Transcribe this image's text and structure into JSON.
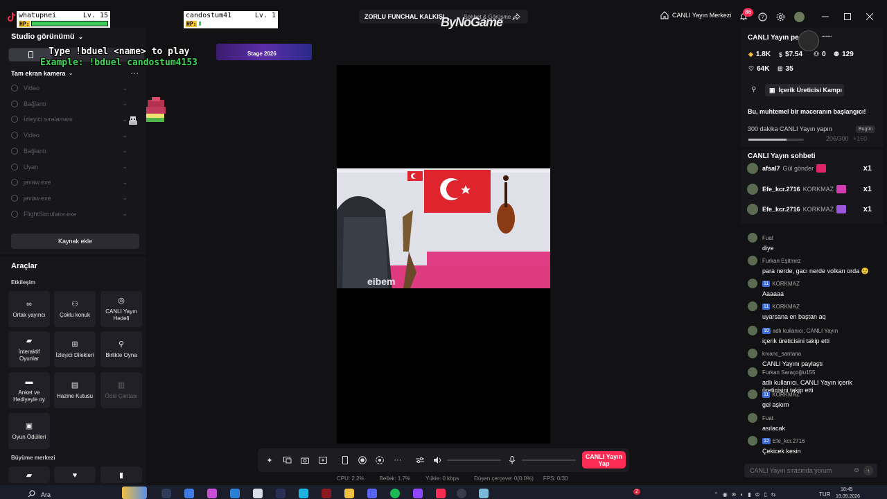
{
  "titlebar": {
    "player1": {
      "name": "whatupnei",
      "level": "Lv. 15",
      "hp_label": "HP:",
      "hp": 1.0
    },
    "player2": {
      "name": "candostum41",
      "level": "Lv. 1",
      "hp_label": "HP:",
      "hp": 0.02
    },
    "stream_title": "ZORLU FUNCHAL KALKIŞI",
    "stream_subtitle": "Sohbet & Görüşme",
    "watermark": "ByNoGame",
    "live_center_label": "CANLI Yayın Merkezi",
    "notification_count": "86"
  },
  "left_panel": {
    "studio_view_label": "Studio görünümü",
    "camera_section": "Tam ekran kamera",
    "sources": [
      "Video",
      "Bağlantı",
      "İzleyici sıralaması",
      "Video",
      "Bağlantı",
      "Uyarı",
      "javaw.exe",
      "javaw.exe",
      "FlightSimulator.exe"
    ],
    "add_source_label": "Kaynak ekle"
  },
  "tools": {
    "title": "Araçlar",
    "interaction_label": "Etkileşim",
    "growth_label": "Büyüme merkezi",
    "items": [
      {
        "label": "Ortak yayıncı",
        "icon": "link-icon"
      },
      {
        "label": "Çoklu konuk",
        "icon": "users-icon"
      },
      {
        "label": "CANLI Yayın Hedefi",
        "icon": "target-icon"
      },
      {
        "label": "İnteraktif Oyunlar",
        "icon": "gamepad-icon"
      },
      {
        "label": "İzleyici Dilekleri",
        "icon": "gift-icon"
      },
      {
        "label": "Birlikte Oyna",
        "icon": "joystick-icon"
      },
      {
        "label": "Anket ve Hediyeyle oy",
        "icon": "poll-icon"
      },
      {
        "label": "Hazine Kutusu",
        "icon": "treasure-icon"
      },
      {
        "label": "Ödül Çantası",
        "icon": "bag-icon"
      },
      {
        "label": "Oyun Ödülleri",
        "icon": "reward-icon"
      }
    ]
  },
  "overlay": {
    "line1": "Type !bduel <name> to play",
    "line2": "Example: !bduel candostum4153",
    "banner_text": "Stage 2026"
  },
  "controls": {
    "go_live_label": "CANLI Yayın Yap"
  },
  "stats": {
    "cpu": "CPU: 2.2%",
    "memory": "Bellek: 1.7%",
    "upload": "Yükle: 0 kbps",
    "dropped": "Düşen çerçeve: 0(0.0%)",
    "fps": "FPS: 0/30"
  },
  "right_panel": {
    "title": "CANLI Yayın pe",
    "stats": {
      "diamonds": "1.8K",
      "money": "$7.54",
      "users": "0",
      "followers": "129",
      "likes": "64K",
      "gifts": "35"
    },
    "campaign_label": "İçerik Üreticisi Kampı",
    "adventure_text": "Bu, muhtemel bir maceranın başlangıcı!",
    "goal_text": "300 dakika CANLI Yayın yapın",
    "goal_badge": "Bugün",
    "goal_progress": "206/300",
    "goal_extra": "+160",
    "goal_fraction": 0.687
  },
  "chat": {
    "title": "CANLI Yayın sohbeti",
    "gifts": [
      {
        "user": "afsal7",
        "text": "Gül gönderildi",
        "count": "x1",
        "color": "#e0246a"
      },
      {
        "user": "Efe_kcr.2716",
        "text": "KORKMAZ adlı k",
        "count": "x1",
        "color": "#d23db2"
      },
      {
        "user": "Efe_kcr.2716",
        "text": "KORKMAZ adlı k",
        "count": "x1",
        "color": "#9c57d8"
      }
    ],
    "messages": [
      {
        "user": "Fuat",
        "level": "",
        "text": "diye"
      },
      {
        "user": "Furkan Eşitmez",
        "level": "",
        "text": "para nerde, gacı nerde volkan orda 😉"
      },
      {
        "user": "KORKMAZ",
        "level": "11",
        "text": "Aaaaaa"
      },
      {
        "user": "KORKMAZ",
        "level": "11",
        "text": "uyarsana en baştan aq"
      },
      {
        "user": "adlı kullanıcı, CANLI Yayın",
        "level": "10",
        "text": "içerik üreticisini takip etti"
      },
      {
        "user": "kıvanc_santana",
        "level": "",
        "text": "CANLI Yayını paylaştı"
      },
      {
        "user": "Furkan Saraçoğlu155",
        "level": "",
        "text": "adlı kullanıcı, CANLI Yayın içerik üreticisini takip etti"
      },
      {
        "user": "KORKMAZ",
        "level": "11",
        "text": "gel aşkım"
      },
      {
        "user": "Fuat",
        "level": "",
        "text": "asılacak"
      },
      {
        "user": "Efe_kcr.2716",
        "level": "12",
        "text": "Çekicek kesin"
      }
    ],
    "input_placeholder": "CANLI Yayın sırasında yorum"
  },
  "taskbar": {
    "search_label": "Ara",
    "language": "TUR",
    "time": "18:45",
    "date": "19.09.2026",
    "badge": "2"
  }
}
